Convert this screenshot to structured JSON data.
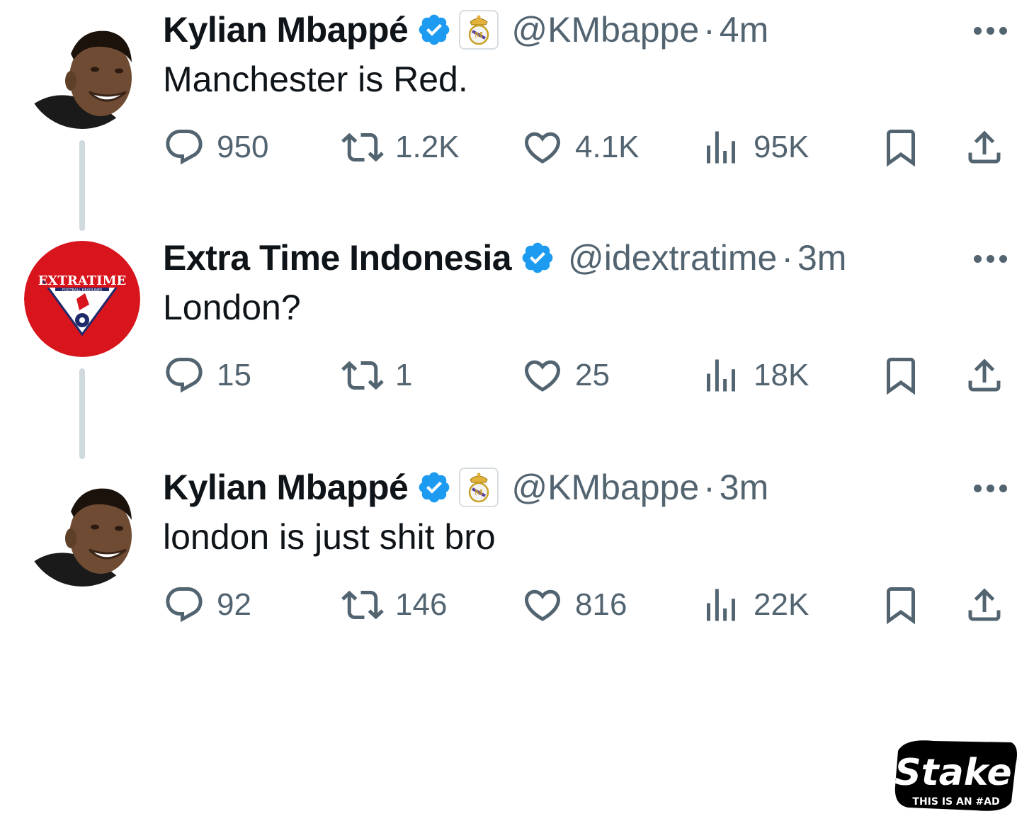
{
  "tweets": [
    {
      "name": "Kylian Mbappé",
      "handle": "@KMbappe",
      "dot": "·",
      "time": "4m",
      "text": "Manchester is Red.",
      "avatar": "mbappe-avatar",
      "affiliation": "real-madrid-crest-icon",
      "replies": "950",
      "reposts": "1.2K",
      "likes": "4.1K",
      "views": "95K"
    },
    {
      "name": "Extra Time Indonesia",
      "handle": "@idextratime",
      "dot": "·",
      "time": "3m",
      "text": "London?",
      "avatar": "extra-time-logo",
      "avatar_label": "EXTRATIME",
      "avatar_sublabel": "FOOTBALL HEADLINES",
      "replies": "15",
      "reposts": "1",
      "likes": "25",
      "views": "18K"
    },
    {
      "name": "Kylian Mbappé",
      "handle": "@KMbappe",
      "dot": "·",
      "time": "3m",
      "text": "london is just shit bro",
      "avatar": "mbappe-avatar",
      "affiliation": "real-madrid-crest-icon",
      "replies": "92",
      "reposts": "146",
      "likes": "816",
      "views": "22K"
    }
  ],
  "ad": {
    "brand": "Stake",
    "tagline": "THIS IS AN #AD"
  },
  "colors": {
    "verified": "#1d9bf0",
    "muted": "#536471",
    "thread_line": "#cfd9de",
    "extra_time_red": "#d8141c"
  }
}
